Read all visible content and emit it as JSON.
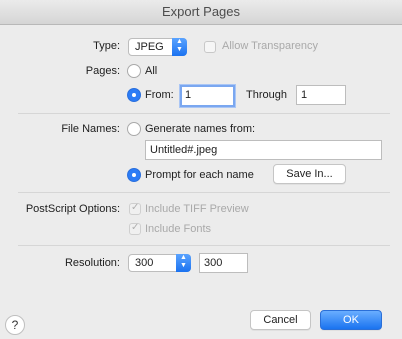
{
  "window": {
    "title": "Export Pages"
  },
  "type": {
    "label": "Type:",
    "value": "JPEG",
    "allow_transparency": "Allow Transparency"
  },
  "pages": {
    "label": "Pages:",
    "all": "All",
    "from_label": "From:",
    "from_value": "1",
    "through_label": "Through",
    "through_value": "1"
  },
  "file_names": {
    "label": "File Names:",
    "generate": "Generate names from:",
    "pattern": "Untitled#.jpeg",
    "prompt": "Prompt for each name",
    "save_in": "Save In..."
  },
  "postscript": {
    "label": "PostScript Options:",
    "tiff": "Include TIFF Preview",
    "fonts": "Include Fonts"
  },
  "resolution": {
    "label": "Resolution:",
    "preset": "300",
    "value": "300"
  },
  "buttons": {
    "help": "?",
    "cancel": "Cancel",
    "ok": "OK"
  },
  "icons": {
    "stepper": "popup-stepper-icon",
    "check": "checkmark-icon"
  },
  "colors": {
    "accent": "#2b7cf6"
  }
}
